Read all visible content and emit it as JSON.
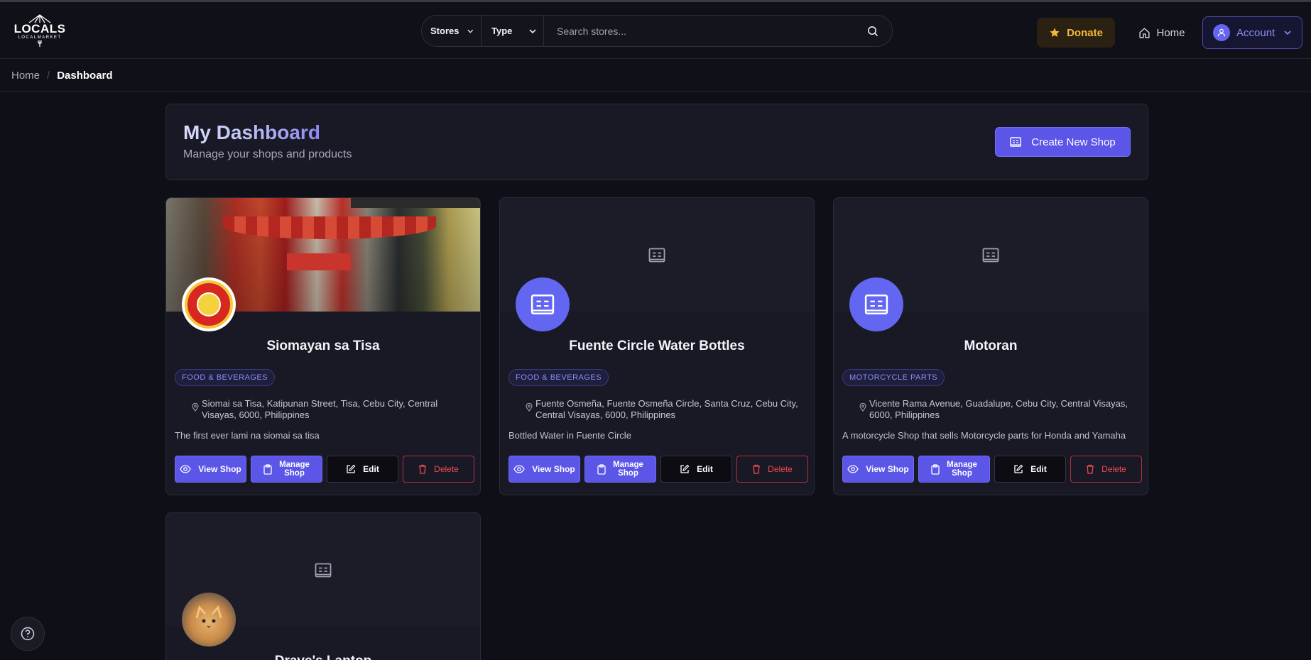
{
  "header": {
    "logo_text": "LOCALS",
    "logo_sub": "LOCALMARKET",
    "filters": [
      {
        "label": "Stores"
      },
      {
        "label": "Type"
      }
    ],
    "search_placeholder": "Search stores...",
    "donate_label": "Donate",
    "home_label": "Home",
    "account_label": "Account"
  },
  "breadcrumb": {
    "home": "Home",
    "separator": "/",
    "current": "Dashboard"
  },
  "dashboard": {
    "title": "My Dashboard",
    "subtitle": "Manage your shops and products",
    "create_label": "Create New Shop"
  },
  "actions": {
    "view": "View Shop",
    "manage_line1": "Manage",
    "manage_line2": "Shop",
    "edit": "Edit",
    "delete": "Delete"
  },
  "shops": [
    {
      "name": "Siomayan sa Tisa",
      "category": "FOOD & BEVERAGES",
      "address": "Siomai sa Tisa, Katipunan Street, Tisa, Cebu City, Central Visayas, 6000, Philippines",
      "description": "The first ever lami na siomai sa tisa",
      "banner": "photo",
      "avatar": "logo-seal"
    },
    {
      "name": "Fuente Circle Water Bottles",
      "category": "FOOD & BEVERAGES",
      "address": "Fuente Osmeña, Fuente Osmeña Circle, Santa Cruz, Cebu City, Central Visayas, 6000, Philippines",
      "description": "Bottled Water in Fuente Circle",
      "banner": "store-icon",
      "avatar": "store-icon"
    },
    {
      "name": "Motoran",
      "category": "MOTORCYCLE PARTS",
      "address": "Vicente Rama Avenue, Guadalupe, Cebu City, Central Visayas, 6000, Philippines",
      "description": "A motorcycle Shop that sells Motorcycle parts for Honda and Yamaha",
      "banner": "store-icon",
      "avatar": "store-icon"
    },
    {
      "name": "Drave's Laptop",
      "banner": "store-icon",
      "avatar": "cat-photo"
    }
  ],
  "colors": {
    "accent": "#5b55e8",
    "donate": "#f5b73b",
    "delete": "#ef4a52",
    "background": "#0f0f17"
  }
}
